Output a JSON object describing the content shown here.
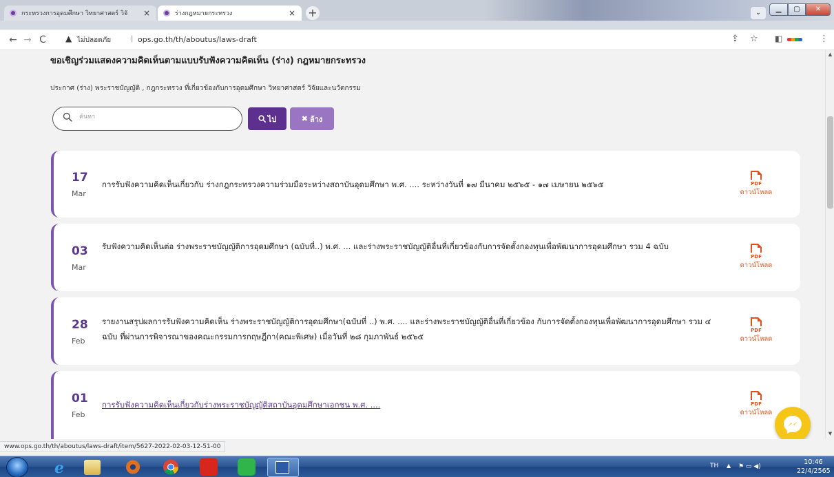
{
  "browser": {
    "tabs": [
      {
        "title": "กระทรวงการอุดมศึกษา วิทยาศาสตร์ วิจั",
        "close": "×"
      },
      {
        "title": "ร่างกฎหมายกระทรวง",
        "close": "×"
      }
    ],
    "new_tab": "+",
    "tab_menu": "⌄",
    "window_buttons": {
      "minimize": "▁",
      "maximize": "▢",
      "close": "✕"
    },
    "nav": {
      "back": "←",
      "forward": "→",
      "reload": "C"
    },
    "security_icon": "▲",
    "security_label": "ไม่ปลอดภัย",
    "separator": "|",
    "url": "ops.go.th/th/aboutus/laws-draft",
    "toolbar_icons": {
      "share": "⇪",
      "star": "☆",
      "side_panel": "◧",
      "menu": "⋮"
    }
  },
  "page": {
    "heading": "ขอเชิญร่วมแสดงความคิดเห็นตามแบบรับฟังความคิดเห็น (ร่าง) กฎหมายกระทรวง",
    "subheading": "ประกาศ (ร่าง) พระราชบัญญัติ , กฎกระทรวง ที่เกี่ยวข้องกับการอุดมศึกษา วิทยาศาสตร์ วิจัยและนวัตกรรม",
    "search": {
      "placeholder": "ค้นหา",
      "value": ""
    },
    "buttons": {
      "go_icon": "🔍",
      "go_label": "ไป",
      "clear_icon": "✖",
      "clear_label": "ล้าง"
    },
    "items": [
      {
        "day": "17",
        "month": "Mar",
        "title": "การรับฟังความคิดเห็นเกี่ยวกับ ร่างกฎกระทรวงความร่วมมือระหว่างสถาบันอุดมศึกษา พ.ศ. .... ระหว่างวันที่ ๑๗ มีนาคม ๒๕๖๕ - ๑๗ เมษายน ๒๕๖๕",
        "download": "ดาวน์โหลด",
        "pdf": "PDF"
      },
      {
        "day": "03",
        "month": "Mar",
        "title": "รับฟังความคิดเห็นต่อ ร่างพระราชบัญญัติการอุดมศึกษา (ฉบับที่..) พ.ศ. ... และร่างพระราชบัญญัติอื่นที่เกี่ยวข้องกับการจัดตั้งกองทุนเพื่อพัฒนาการอุดมศึกษา รวม 4 ฉบับ",
        "download": "ดาวน์โหลด",
        "pdf": "PDF"
      },
      {
        "day": "28",
        "month": "Feb",
        "title": "รายงานสรุปผลการรับฟังความคิดเห็น ร่างพระราชบัญญัติการอุดมศึกษา(ฉบับที่ ..) พ.ศ. .... และร่างพระราชบัญญัติอื่นที่เกี่ยวข้อง กับการจัดตั้งกองทุนเพื่อพัฒนาการอุดมศึกษา รวม ๔ ฉบับ ที่ผ่านการพิจารณาของคณะกรรมการกฤษฎีกา(คณะพิเศษ) เมื่อวันที่ ๒๘ กุมภาพันธ์ ๒๕๖๕",
        "download": "ดาวน์โหลด",
        "pdf": "PDF"
      },
      {
        "day": "01",
        "month": "Feb",
        "title": "การรับฟังความคิดเห็นเกี่ยวกับร่างพระราชบัญญัติสถาบันอุดมศึกษาเอกชน พ.ศ. ....",
        "download": "ดาวน์โหลด",
        "pdf": "PDF"
      }
    ]
  },
  "status_url": "www.ops.go.th/th/aboutus/laws-draft/item/5627-2022-02-03-12-51-00",
  "scrollbar": {
    "up": "▲",
    "down": "▼"
  },
  "taskbar": {
    "language": "TH",
    "tray_arrow": "▲",
    "tray_icons": "⚑ ▭ ◀)",
    "time": "10:46",
    "date": "22/4/2565"
  },
  "colors": {
    "accent": "#5d2f8f",
    "accent_light": "#9a75c2",
    "pdf": "#e2501c",
    "messenger": "#f5c518"
  }
}
